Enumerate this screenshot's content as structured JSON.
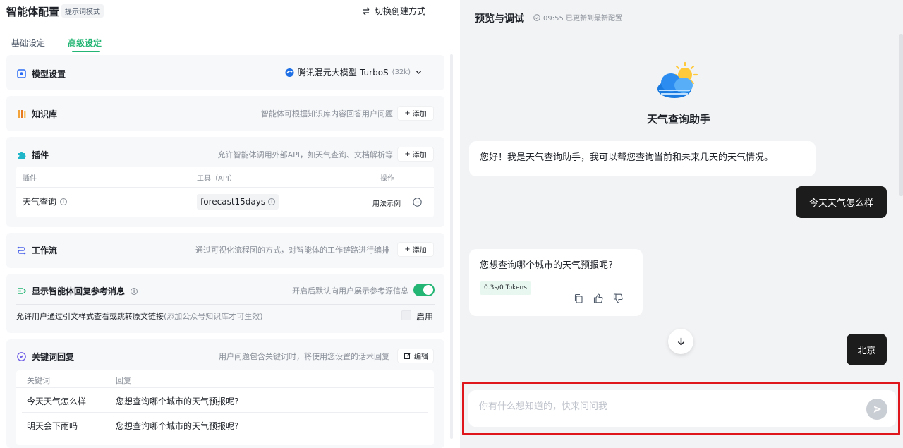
{
  "header": {
    "title": "智能体配置",
    "mode_tag": "提示词模式",
    "switch_label": "切换创建方式"
  },
  "tabs": [
    {
      "label": "基础设定",
      "active": false
    },
    {
      "label": "高级设定",
      "active": true
    }
  ],
  "model": {
    "title": "模型设置",
    "name": "腾讯混元大模型-TurboS",
    "context": "(32k)"
  },
  "knowledge": {
    "title": "知识库",
    "desc": "智能体可根据知识库内容回答用户问题",
    "add_label": "添加"
  },
  "plugins": {
    "title": "插件",
    "desc": "允许智能体调用外部API，如天气查询、文档解析等",
    "add_label": "添加",
    "columns": [
      "插件",
      "工具（API）",
      "操作"
    ],
    "rows": [
      {
        "name": "天气查询",
        "tool": "forecast15days",
        "action": "用法示例"
      }
    ]
  },
  "workflow": {
    "title": "工作流",
    "desc": "通过可视化流程图的方式，对智能体的工作链路进行编排",
    "add_label": "添加"
  },
  "reference": {
    "title": "显示智能体回复参考消息",
    "desc": "开启后默认向用户展示参考源信息",
    "enabled": true,
    "sub_text": "允许用户通过引文样式查看或跳转原文链接",
    "sub_note": "(添加公众号知识库才可生效)",
    "checkbox_label": "启用"
  },
  "keywords": {
    "title": "关键词回复",
    "desc": "用户问题包含关键词时，将使用您设置的话术回复",
    "edit_label": "编辑",
    "columns": [
      "关键词",
      "回复"
    ],
    "rows": [
      {
        "keyword": "今天天气怎么样",
        "reply": "您想查询哪个城市的天气预报呢?"
      },
      {
        "keyword": "明天会下雨吗",
        "reply": "您想查询哪个城市的天气预报呢?"
      }
    ]
  },
  "preview": {
    "title": "预览与调试",
    "status": "09:55 已更新到最新配置",
    "bot_name": "天气查询助手",
    "messages": [
      {
        "role": "bot",
        "text": "您好！我是天气查询助手，我可以帮您查询当前和未来几天的天气情况。"
      },
      {
        "role": "user",
        "text": "今天天气怎么样"
      },
      {
        "role": "bot",
        "text": "您想查询哪个城市的天气预报呢?",
        "tokens": "0.3s/0 Tokens"
      },
      {
        "role": "user",
        "text": "北京"
      }
    ],
    "input_placeholder": "你有什么想知道的，快来问问我"
  },
  "colors": {
    "accent": "#22b573",
    "highlight_border": "#e0161d",
    "user_bubble": "#1c1c1c"
  }
}
